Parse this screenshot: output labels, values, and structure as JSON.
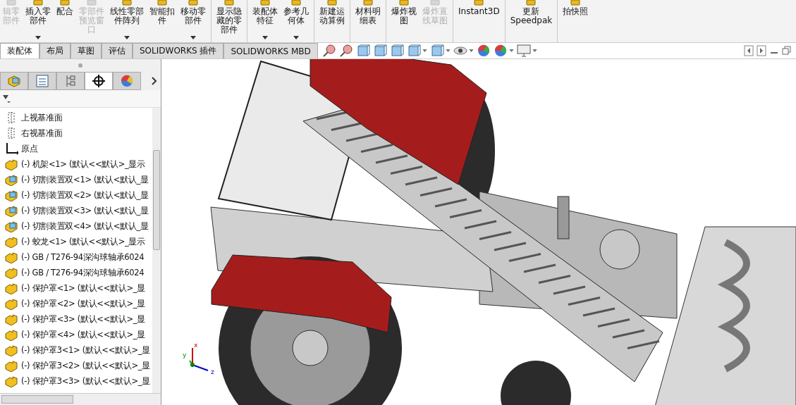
{
  "ribbon": {
    "buttons": [
      {
        "lines": [
          "辑零",
          "部件"
        ],
        "disabled": true,
        "dropdown": false,
        "group_end": false
      },
      {
        "lines": [
          "插入零",
          "部件"
        ],
        "disabled": false,
        "dropdown": true,
        "group_end": false
      },
      {
        "lines": [
          "配合"
        ],
        "disabled": false,
        "dropdown": false,
        "group_end": false
      },
      {
        "lines": [
          "零部件",
          "预览窗",
          "口"
        ],
        "disabled": true,
        "dropdown": false,
        "group_end": false
      },
      {
        "lines": [
          "线性零部",
          "件阵列"
        ],
        "disabled": false,
        "dropdown": true,
        "group_end": false
      },
      {
        "lines": [
          "智能扣",
          "件"
        ],
        "disabled": false,
        "dropdown": false,
        "group_end": false
      },
      {
        "lines": [
          "移动零",
          "部件"
        ],
        "disabled": false,
        "dropdown": true,
        "group_end": true
      },
      {
        "lines": [
          "显示隐",
          "藏的零",
          "部件"
        ],
        "disabled": false,
        "dropdown": false,
        "group_end": true
      },
      {
        "lines": [
          "装配体",
          "特征"
        ],
        "disabled": false,
        "dropdown": true,
        "group_end": false
      },
      {
        "lines": [
          "参考几",
          "何体"
        ],
        "disabled": false,
        "dropdown": true,
        "group_end": true
      },
      {
        "lines": [
          "新建运",
          "动算例"
        ],
        "disabled": false,
        "dropdown": false,
        "group_end": true
      },
      {
        "lines": [
          "材料明",
          "细表"
        ],
        "disabled": false,
        "dropdown": false,
        "group_end": true
      },
      {
        "lines": [
          "爆炸视",
          "图"
        ],
        "disabled": false,
        "dropdown": false,
        "group_end": false
      },
      {
        "lines": [
          "爆炸直",
          "线草图"
        ],
        "disabled": true,
        "dropdown": false,
        "group_end": true
      },
      {
        "lines": [
          "Instant3D"
        ],
        "disabled": false,
        "dropdown": false,
        "group_end": true
      },
      {
        "lines": [
          "更新",
          "Speedpak"
        ],
        "disabled": false,
        "dropdown": false,
        "group_end": true
      },
      {
        "lines": [
          "拍快照"
        ],
        "disabled": false,
        "dropdown": false,
        "group_end": false
      }
    ]
  },
  "tabs": [
    {
      "label": "装配体",
      "selected": true
    },
    {
      "label": "布局",
      "selected": false
    },
    {
      "label": "草图",
      "selected": false
    },
    {
      "label": "评估",
      "selected": false
    },
    {
      "label": "SOLIDWORKS 插件",
      "selected": false
    },
    {
      "label": "SOLIDWORKS MBD",
      "selected": false
    }
  ],
  "panel_tabs": [
    {
      "kind": "assembly",
      "selected": false
    },
    {
      "kind": "properties",
      "selected": false
    },
    {
      "kind": "config",
      "selected": false
    },
    {
      "kind": "target",
      "selected": true
    },
    {
      "kind": "appearance",
      "selected": false
    }
  ],
  "tree": {
    "items": [
      {
        "kind": "plane",
        "label": "上视基准面"
      },
      {
        "kind": "plane",
        "label": "右视基准面"
      },
      {
        "kind": "origin",
        "label": "原点"
      },
      {
        "kind": "part",
        "label": "(-) 机架<1> (默认<<默认>_显示"
      },
      {
        "kind": "assembly",
        "label": "(-) 切割装置双<1> (默认<默认_显"
      },
      {
        "kind": "assembly",
        "label": "(-) 切割装置双<2> (默认<默认_显"
      },
      {
        "kind": "assembly",
        "label": "(-) 切割装置双<3> (默认<默认_显"
      },
      {
        "kind": "assembly",
        "label": "(-) 切割装置双<4> (默认<默认_显"
      },
      {
        "kind": "part",
        "label": "(-) 蛟龙<1> (默认<<默认>_显示"
      },
      {
        "kind": "part",
        "label": "(-) GB / T276-94深沟球轴承6024"
      },
      {
        "kind": "part",
        "label": "(-) GB / T276-94深沟球轴承6024"
      },
      {
        "kind": "part",
        "label": "(-) 保护罩<1> (默认<<默认>_显"
      },
      {
        "kind": "part",
        "label": "(-) 保护罩<2> (默认<<默认>_显"
      },
      {
        "kind": "part",
        "label": "(-) 保护罩<3> (默认<<默认>_显"
      },
      {
        "kind": "part",
        "label": "(-) 保护罩<4> (默认<<默认>_显"
      },
      {
        "kind": "part",
        "label": "(-) 保护罩3<1> (默认<<默认>_显"
      },
      {
        "kind": "part",
        "label": "(-) 保护罩3<2> (默认<<默认>_显"
      },
      {
        "kind": "part",
        "label": "(-) 保护罩3<3> (默认<<默认>_显"
      }
    ]
  },
  "triad": {
    "x": "x",
    "y": "y",
    "z": "z"
  }
}
